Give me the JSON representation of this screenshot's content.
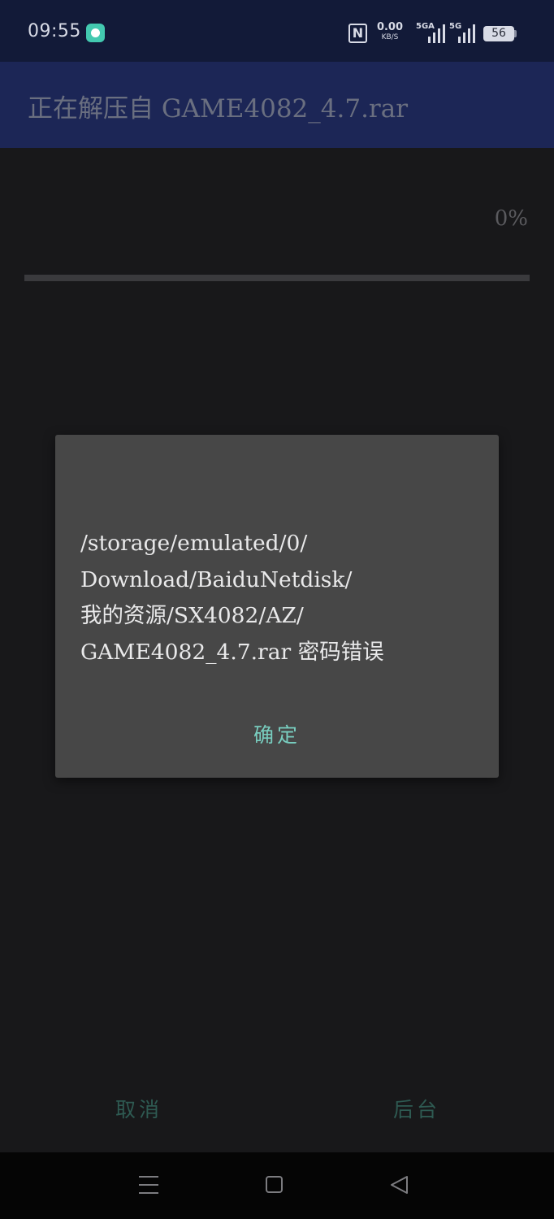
{
  "status_bar": {
    "time": "09:55",
    "app_icon": "chat-bubble-icon",
    "nfc_label": "N",
    "net_speed_value": "0.00",
    "net_speed_unit": "KB/S",
    "sim1_label": "5GA",
    "sim2_label": "5G",
    "battery_level": "56"
  },
  "header": {
    "title": "正在解压自 GAME4082_4.7.rar"
  },
  "progress": {
    "percent_text": "0%",
    "fraction": 0
  },
  "dialog": {
    "message": "/storage/emulated/0/\nDownload/BaiduNetdisk/\n我的资源/SX4082/AZ/\nGAME4082_4.7.rar 密码错误",
    "ok_label": "确定"
  },
  "actions": {
    "cancel_label": "取消",
    "background_label": "后台"
  },
  "nav_bar": {
    "menu_icon": "menu-icon",
    "home_icon": "home-icon",
    "back_icon": "back-icon"
  },
  "colors": {
    "status_bar_bg": "#121a38",
    "title_bar_bg": "#1c2656",
    "dialog_bg": "#474747",
    "accent_teal": "#78cdbf"
  }
}
